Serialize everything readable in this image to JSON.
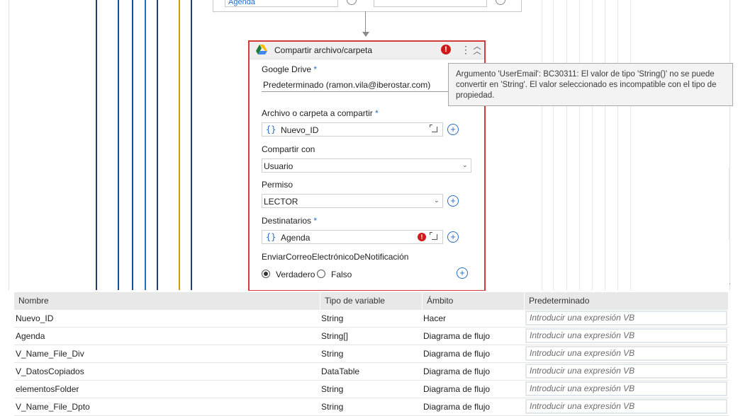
{
  "activity": {
    "title": "Compartir archivo/carpeta",
    "error_mark": "!",
    "fields": {
      "google_drive_label": "Google Drive",
      "google_drive_value": "Predeterminado (ramon.vila@iberostar.com)",
      "file_label": "Archivo o carpeta a compartir",
      "file_value": "Nuevo_ID",
      "share_with_label": "Compartir con",
      "share_with_value": "Usuario",
      "permission_label": "Permiso",
      "permission_value": "LECTOR",
      "recipients_label": "Destinatarios",
      "recipients_value": "Agenda",
      "notify_label": "EnviarCorreoElectrónicoDeNotificación",
      "notify_true": "Verdadero",
      "notify_false": "Falso",
      "notify_selected": "Verdadero"
    },
    "required_mark": "*",
    "expr_glyph": "{}"
  },
  "prev_activity": {
    "field1": "Agenda"
  },
  "tooltip": {
    "text": "Argumento 'UserEmail': BC30311: El valor de tipo 'String()' no se puede convertir en 'String'. El valor seleccionado es incompatible con el tipo de propiedad."
  },
  "variables": {
    "headers": [
      "Nombre",
      "Tipo de variable",
      "Ámbito",
      "Predeterminado"
    ],
    "placeholder": "Introducir una expresión VB",
    "rows": [
      {
        "name": "Nuevo_ID",
        "type": "String",
        "scope": "Hacer"
      },
      {
        "name": "Agenda",
        "type": "String[]",
        "scope": "Diagrama de flujo"
      },
      {
        "name": "V_Name_File_Div",
        "type": "String",
        "scope": "Diagrama de flujo"
      },
      {
        "name": "V_DatosCopiados",
        "type": "DataTable",
        "scope": "Diagrama de flujo"
      },
      {
        "name": "elementosFolder",
        "type": "String",
        "scope": "Diagrama de flujo"
      },
      {
        "name": "V_Name_File_Dpto",
        "type": "String",
        "scope": "Diagrama de flujo"
      }
    ]
  },
  "colors": {
    "error_border": "#d63b3b",
    "accent_blue": "#2b6cc4",
    "flow_line_navy": "#1d3b6e",
    "flow_line_blue": "#1c6fd0",
    "flow_line_gold": "#c8a000"
  }
}
